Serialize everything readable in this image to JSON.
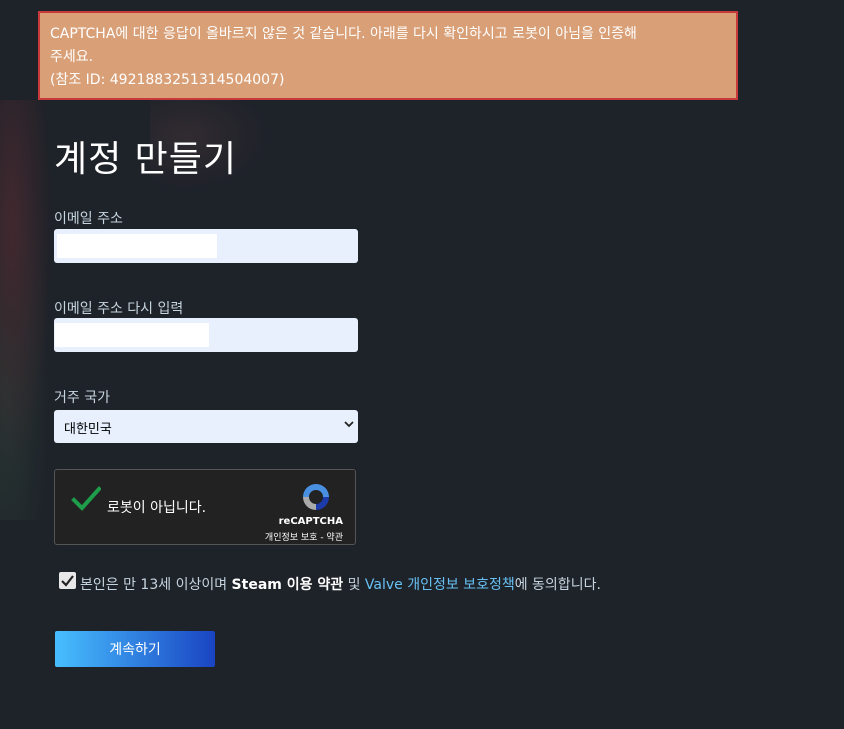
{
  "error": {
    "line1": "CAPTCHA에 대한 응답이 올바르지 않은 것 같습니다. 아래를 다시 확인하시고 로봇이 아님을 인증해",
    "line2": "주세요.",
    "line3": "(참조 ID: 4921883251314504007)"
  },
  "page": {
    "title": "계정 만들기"
  },
  "form": {
    "email_label": "이메일 주소",
    "email_value": "",
    "email_confirm_label": "이메일 주소 다시 입력",
    "email_confirm_value": "",
    "country_label": "거주 국가",
    "country_selected": "대한민국"
  },
  "recaptcha": {
    "label": "로봇이 아닙니다.",
    "brand": "reCAPTCHA",
    "links": "개인정보 보호 - 약관",
    "checked": true
  },
  "agreement": {
    "text_before": "본인은 만 13세 이상이며 ",
    "steam_terms": "Steam 이용 약관",
    "text_and": " 및 ",
    "valve_privacy": "Valve 개인정보 보호정책",
    "text_after": "에 동의합니다.",
    "checked": true
  },
  "continue_label": "계속하기",
  "colors": {
    "background": "#1e2229",
    "error_bg": "#d9a078",
    "error_border": "#c7393b",
    "link": "#66c0f4",
    "button_start": "#47bfff",
    "button_end": "#1a44c2",
    "check_green": "#1e9e4a"
  }
}
